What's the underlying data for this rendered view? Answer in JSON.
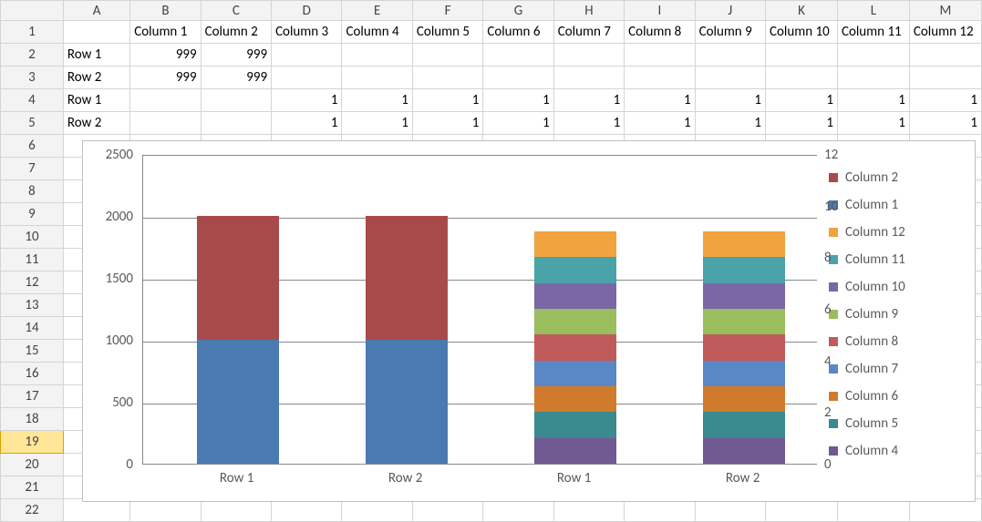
{
  "col_letters": [
    "A",
    "B",
    "C",
    "D",
    "E",
    "F",
    "G",
    "H",
    "I",
    "J",
    "K",
    "L",
    "M"
  ],
  "row_numbers": [
    "1",
    "2",
    "3",
    "4",
    "5",
    "6",
    "7",
    "8",
    "9",
    "10",
    "11",
    "12",
    "13",
    "14",
    "15",
    "16",
    "17",
    "18",
    "19",
    "20",
    "21",
    "22"
  ],
  "selected_row": 19,
  "spreadsheet": {
    "headers": [
      "",
      "Column 1",
      "Column 2",
      "Column 3",
      "Column 4",
      "Column 5",
      "Column 6",
      "Column 7",
      "Column 8",
      "Column 9",
      "Column 10",
      "Column 11",
      "Column 12"
    ],
    "rows": [
      {
        "label": "Row 1",
        "cells": [
          "999",
          "999",
          "",
          "",
          "",
          "",
          "",
          "",
          "",
          "",
          "",
          ""
        ]
      },
      {
        "label": "Row 2",
        "cells": [
          "999",
          "999",
          "",
          "",
          "",
          "",
          "",
          "",
          "",
          "",
          "",
          ""
        ]
      },
      {
        "label": "Row 1",
        "cells": [
          "",
          "",
          "1",
          "1",
          "1",
          "1",
          "1",
          "1",
          "1",
          "1",
          "1",
          "1"
        ]
      },
      {
        "label": "Row 2",
        "cells": [
          "",
          "",
          "1",
          "1",
          "1",
          "1",
          "1",
          "1",
          "1",
          "1",
          "1",
          "1"
        ]
      }
    ]
  },
  "chart_data": {
    "type": "bar",
    "stacked": true,
    "secondary_axis": {
      "ylim": [
        0,
        12
      ],
      "ticks": [
        0,
        2,
        4,
        6,
        8,
        10,
        12
      ],
      "series": [
        {
          "name": "Column 4",
          "color": "#6f5a91",
          "values": [
            1,
            1
          ]
        },
        {
          "name": "Column 5",
          "color": "#3a8a8f",
          "values": [
            1,
            1
          ]
        },
        {
          "name": "Column 6",
          "color": "#d07a2e",
          "values": [
            1,
            1
          ]
        },
        {
          "name": "Column 7",
          "color": "#5a87c6",
          "values": [
            1,
            1
          ]
        },
        {
          "name": "Column 8",
          "color": "#c05a5a",
          "values": [
            1,
            1
          ]
        },
        {
          "name": "Column 9",
          "color": "#9abd5e",
          "values": [
            1,
            1
          ]
        },
        {
          "name": "Column 10",
          "color": "#7b67a6",
          "values": [
            1,
            1
          ]
        },
        {
          "name": "Column 11",
          "color": "#4aa3a8",
          "values": [
            1,
            1
          ]
        },
        {
          "name": "Column 12",
          "color": "#f0a33e",
          "values": [
            1,
            1
          ]
        }
      ]
    },
    "categories_primary": [
      "Row 1",
      "Row 2"
    ],
    "categories_secondary": [
      "Row 1",
      "Row 2"
    ],
    "primary_axis": {
      "ylim": [
        0,
        2500
      ],
      "ticks": [
        0,
        500,
        1000,
        1500,
        2000,
        2500
      ],
      "series": [
        {
          "name": "Column 1",
          "color": "#4a7ab0",
          "values": [
            999,
            999
          ]
        },
        {
          "name": "Column 2",
          "color": "#a94a4a",
          "values": [
            999,
            999
          ]
        }
      ]
    },
    "legend_order": [
      {
        "name": "Column 2",
        "color": "#a94a4a"
      },
      {
        "name": "Column 1",
        "color": "#4a7ab0"
      },
      {
        "name": "Column 12",
        "color": "#f0a33e"
      },
      {
        "name": "Column 11",
        "color": "#4aa3a8"
      },
      {
        "name": "Column 10",
        "color": "#7b67a6"
      },
      {
        "name": "Column 9",
        "color": "#9abd5e"
      },
      {
        "name": "Column 8",
        "color": "#c05a5a"
      },
      {
        "name": "Column 7",
        "color": "#5a87c6"
      },
      {
        "name": "Column 6",
        "color": "#d07a2e"
      },
      {
        "name": "Column 5",
        "color": "#3a8a8f"
      },
      {
        "name": "Column 4",
        "color": "#6f5a91"
      }
    ],
    "x_labels": [
      "Row 1",
      "Row 2",
      "Row 1",
      "Row 2"
    ]
  }
}
